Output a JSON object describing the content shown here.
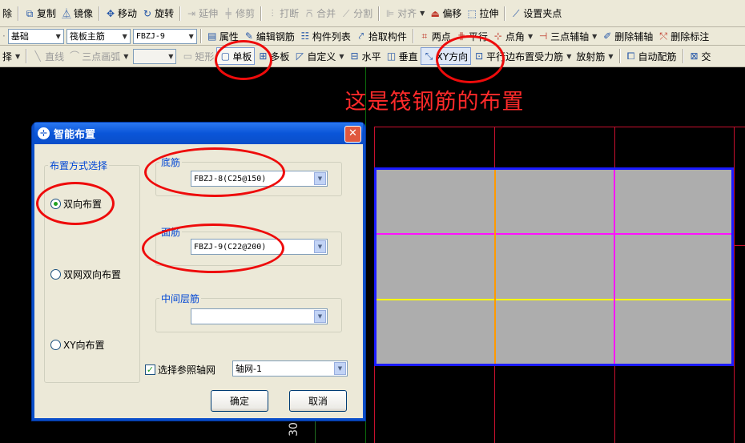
{
  "toolbar1": {
    "delete_frag": "除",
    "copy": "复制",
    "mirror": "镜像",
    "move": "移动",
    "rotate": "旋转",
    "extend": "延伸",
    "trim": "修剪",
    "break": "打断",
    "merge": "合并",
    "split": "分割",
    "align": "对齐",
    "offset": "偏移",
    "stretch": "拉伸",
    "grip": "设置夹点"
  },
  "toolbar2": {
    "layer_select": "基础",
    "type_select": "筏板主筋",
    "component_select": "FBZJ-9",
    "properties": "属性",
    "edit_rebar": "编辑钢筋",
    "component_list": "构件列表",
    "pick_component": "拾取构件",
    "two_points": "两点",
    "parallel": "平行",
    "point_angle": "点角",
    "three_point_aux": "三点辅轴",
    "delete_aux": "删除辅轴",
    "delete_label": "删除标注"
  },
  "toolbar3": {
    "select_frag": "择",
    "line": "直线",
    "arc": "三点画弧",
    "rect": "矩形",
    "single_slab": "单板",
    "multi_slab": "多板",
    "custom": "自定义",
    "horizontal": "水平",
    "vertical": "垂直",
    "xy_direction": "XY方向",
    "parallel_edge": "平行边布置受力筋",
    "radial": "放射筋",
    "auto_rebar": "自动配筋",
    "intersect_frag": "交"
  },
  "canvas": {
    "annotation": "这是筏钢筋的布置",
    "dimension_text": "30"
  },
  "dialog": {
    "title": "智能布置",
    "layout_group_label": "布置方式选择",
    "radio_bidirectional": "双向布置",
    "radio_double_mesh": "双网双向布置",
    "radio_xy": "XY向布置",
    "bottom_rebar_label": "底筋",
    "bottom_rebar_value": "FBZJ-8(C25@150)",
    "top_rebar_label": "面筋",
    "top_rebar_value": "FBZJ-9(C22@200)",
    "middle_rebar_label": "中间层筋",
    "middle_rebar_value": "",
    "ref_axis_checkbox": "选择参照轴网",
    "axis_grid_value": "轴网-1",
    "ok_button": "确定",
    "cancel_button": "取消"
  },
  "colors": {
    "annotation_red": "#ff2a2a",
    "highlight_ring": "#ee0b0b",
    "slab_fill": "#adadad",
    "slab_border": "#1b1bff",
    "rebar_magenta": "#ff10ff",
    "rebar_yellow": "#ffff00",
    "rebar_orange": "#ff9a00",
    "grid_red": "#c8102e"
  }
}
